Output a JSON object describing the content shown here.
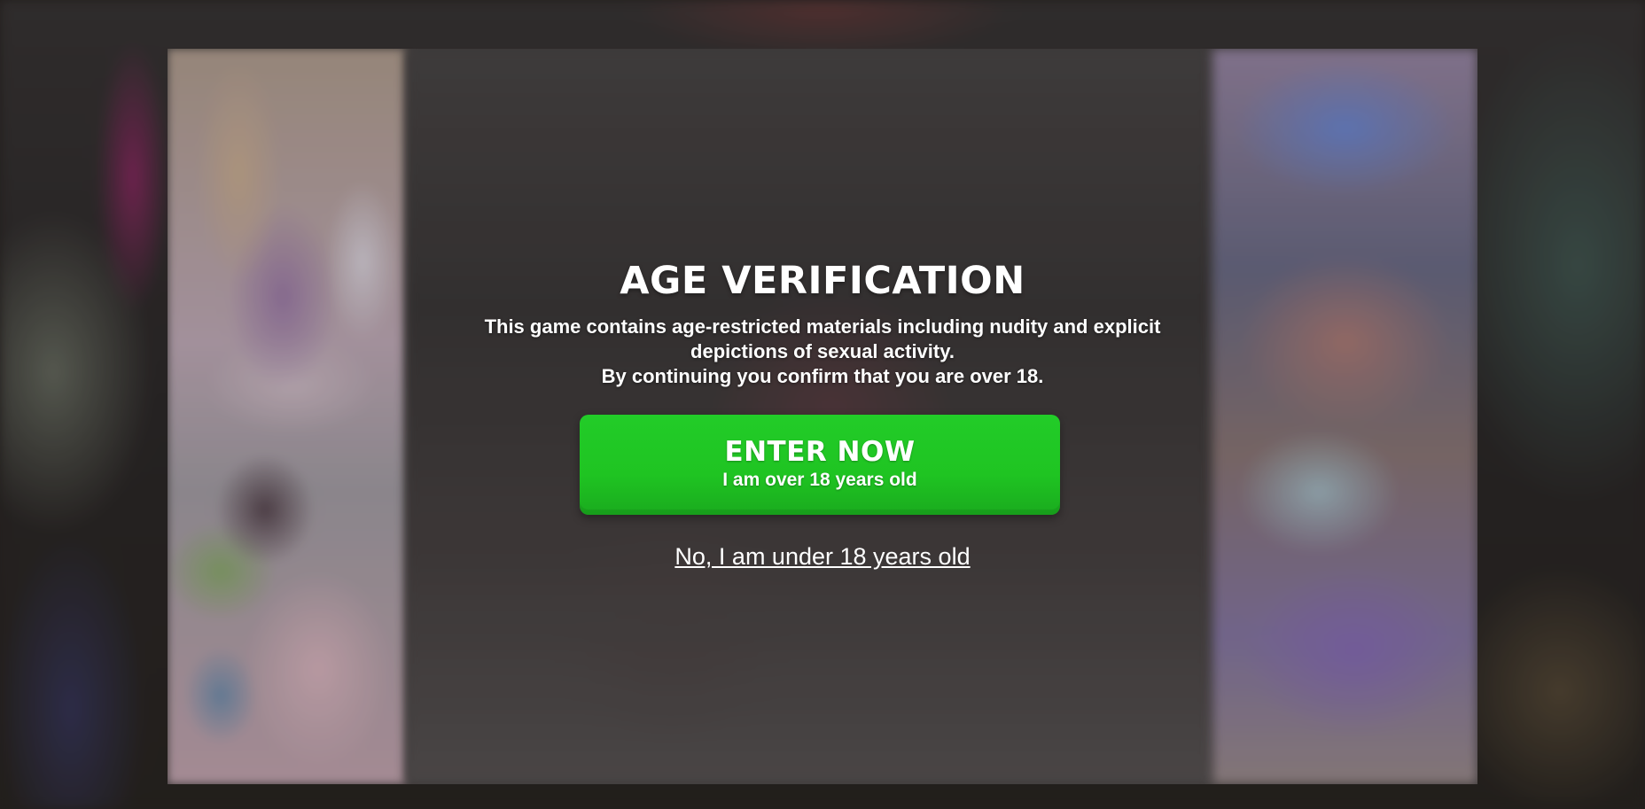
{
  "age_gate": {
    "title": "AGE VERIFICATION",
    "description_line1": "This game contains age-restricted materials including nudity and explicit",
    "description_line2": "depictions of sexual activity.",
    "description_line3": "By continuing you confirm that you are over 18.",
    "enter_button": {
      "label": "ENTER NOW",
      "sublabel": "I am over 18 years old"
    },
    "under_link": "No, I am under 18 years old"
  },
  "colors": {
    "enter_button": "#1fc422",
    "text": "#ffffff"
  }
}
